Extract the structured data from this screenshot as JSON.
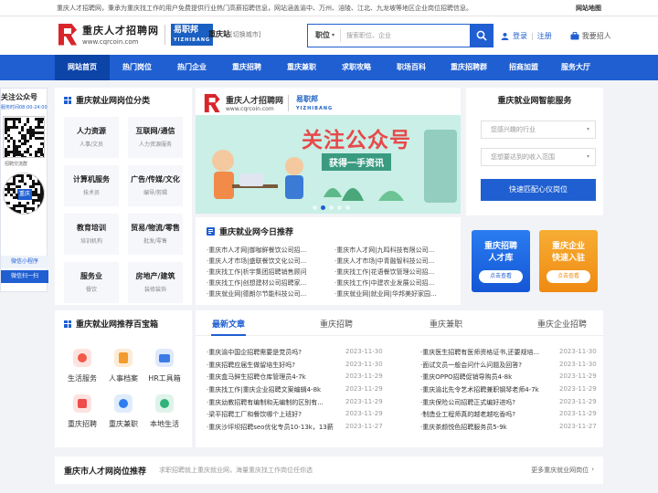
{
  "topbar": {
    "notice": "重庆人才招聘网，秉承为重庆找工作的用户免费提供行业热门高薪招聘信息，网站涵盖渝中、万州、涪陵、江北、九龙坡等地区企业岗位招聘信息。",
    "sitemap": "网站地图"
  },
  "header": {
    "logo_cn": "重庆人才招聘网",
    "logo_url": "www.cqrcoin.com",
    "yzb": "易职邦",
    "yzb_en": "YIZHIBANG",
    "city": "重庆站",
    "city_switch": "[切换城市]",
    "search_category": "职位",
    "search_placeholder": "搜索职位、企业",
    "login": "登录",
    "register": "注册",
    "hire": "我要招人"
  },
  "nav": [
    "网站首页",
    "热门岗位",
    "热门企业",
    "重庆招聘",
    "重庆兼职",
    "求职攻略",
    "职场百科",
    "重庆招聘群",
    "招商加盟",
    "服务大厅"
  ],
  "side": {
    "title": "关注公众号",
    "hours": "服务时间08:00-24:00",
    "group_label": "招聘交流群",
    "mini": "微信小程序",
    "mini_btn": "微信扫一扫",
    "stamp": "重庆"
  },
  "categories": {
    "title": "重庆就业网岗位分类",
    "items": [
      {
        "t": "人力资源",
        "s": "人事/文员"
      },
      {
        "t": "互联网/通信",
        "s": "人力资源服务"
      },
      {
        "t": "计算机服务",
        "s": "技术员"
      },
      {
        "t": "广告/传媒/文化",
        "s": "编导/剪辑"
      },
      {
        "t": "教育培训",
        "s": "培训机构"
      },
      {
        "t": "贸易/物流/零售",
        "s": "批发/零售"
      },
      {
        "t": "服务业",
        "s": "餐饮"
      },
      {
        "t": "房地产/建筑",
        "s": "装修装饰"
      }
    ]
  },
  "banner": {
    "logo_cn": "重庆人才招聘网",
    "logo_url": "www.cqrcoin.com",
    "yzb": "易职邦",
    "yzb_en": "YIZHIBANG",
    "title": "关注公众号",
    "subtitle": "获得一手资讯"
  },
  "today": {
    "title": "重庆就业网今日推荐",
    "left": [
      "·重庆市人才网|御咖鲜餐饮公司招...",
      "·重庆人才市场|盛联餐饮文化公司...",
      "·重庆找工作|析宇集团招聘销售顾问",
      "·重庆找工作|创想建材公司招聘家...",
      "·重庆就业网|德朗尔节能科技公司..."
    ],
    "right": [
      "·重庆市人才网|九鸣科技有限公司...",
      "·重庆人才市场|中青融智科技公司...",
      "·重庆找工作|花语餐饮管理公司招...",
      "·重庆找工作|中建农业发展公司招...",
      "·重庆就业网|就业网|华邦美好家园..."
    ]
  },
  "service": {
    "title": "重庆就业网智能服务",
    "industry": "您感兴趣的行业",
    "salary": "您想要达到的收入范围",
    "match_btn": "快速匹配心仪岗位"
  },
  "promos": [
    {
      "t1": "重庆招聘",
      "t2": "人才库",
      "btn": "点击查看"
    },
    {
      "t1": "重庆企业",
      "t2": "快速入驻",
      "btn": "点击查看"
    }
  ],
  "toolbox": {
    "title": "重庆就业网推荐百宝箱",
    "items": [
      "生活服务",
      "人事档案",
      "HR工具箱",
      "重庆招聘",
      "重庆兼职",
      "本地生活"
    ]
  },
  "news": {
    "tabs": [
      "最新文章",
      "重庆招聘",
      "重庆兼职",
      "重庆企业招聘"
    ],
    "left": [
      {
        "t": "·重庆渝中国企招聘需要是党员吗?",
        "d": "2023-11-30"
      },
      {
        "t": "·重庆招聘应届生做留培生好吗?",
        "d": "2023-11-30"
      },
      {
        "t": "·重庆盒马鲜生招聘仓库管理员4-7k",
        "d": "2023-11-29"
      },
      {
        "t": "·重庆找工作|重庆企业招聘文案编辑4-8k",
        "d": "2023-11-29"
      },
      {
        "t": "·重庆幼教招聘有编制和无编制的区别有...",
        "d": "2023-11-29"
      },
      {
        "t": "·梁平招聘工厂和餐饮哪个上班好?",
        "d": "2023-11-29"
      },
      {
        "t": "·重庆沙坪坝招聘seo优化专员10-13k，13薪",
        "d": "2023-11-27"
      }
    ],
    "right": [
      {
        "t": "·重庆医生招聘有医师资格证书,还要规培...",
        "d": "2023-11-30"
      },
      {
        "t": "·面试文员一般会问什么问题及回答?",
        "d": "2023-11-30"
      },
      {
        "t": "·重庆OPPO招聘促销导购员4-8k",
        "d": "2023-11-29"
      },
      {
        "t": "·重庆渝北先令艺术招聘兼职钢琴老师4-7k",
        "d": "2023-11-29"
      },
      {
        "t": "·重庆保险公司招聘正式编好进吗?",
        "d": "2023-11-29"
      },
      {
        "t": "·制造业工程师真的越老越吃香吗?",
        "d": "2023-11-29"
      },
      {
        "t": "·重庆茶颜悦色招聘服务员5-9k",
        "d": "2023-11-27"
      }
    ]
  },
  "bottom": {
    "title": "重庆市人才网岗位推荐",
    "desc": "求职招聘就上重庆就业网，海量重庆找工作岗位任你选",
    "more": "更多重庆就业网岗位"
  },
  "colors": {
    "brand": "#1f5fd1",
    "nav_active": "#0d44a8",
    "accent_red": "#d9252a",
    "promo_blue": "#1a6be6",
    "promo_orange": "#f29a1c"
  }
}
